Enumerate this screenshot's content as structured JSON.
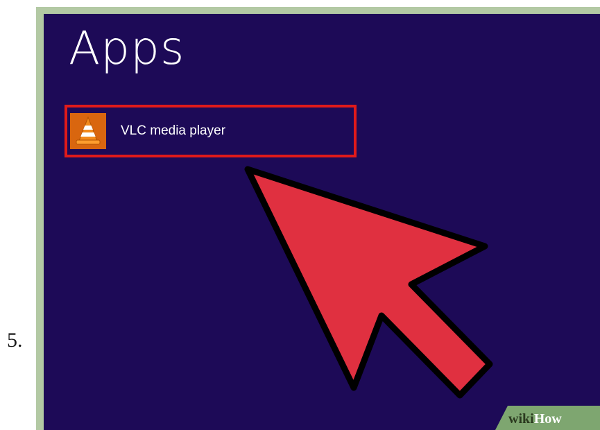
{
  "step": {
    "number": "5."
  },
  "start_screen": {
    "heading": "Apps",
    "apps": [
      {
        "label": "VLC media player",
        "icon": "vlc-cone-icon",
        "highlighted": true
      }
    ]
  },
  "pointer": {
    "icon": "arrow-pointer-icon",
    "color": "#e03040"
  },
  "watermark": {
    "prefix": "wiki",
    "suffix": "How"
  },
  "colors": {
    "screen_background": "#1d0a57",
    "highlight_border": "#e11a1a",
    "app_tile": "#d9660f",
    "frame": "#b3c9a4"
  }
}
